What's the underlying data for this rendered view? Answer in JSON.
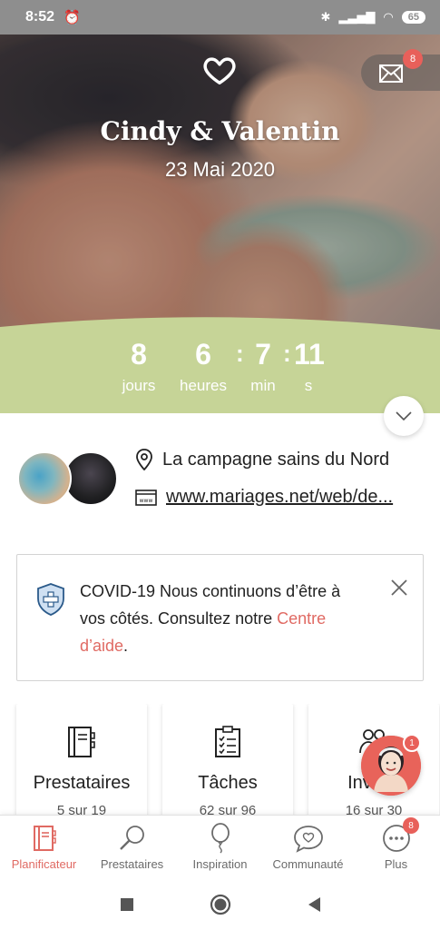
{
  "status_bar": {
    "time": "8:52",
    "battery": "65"
  },
  "hero": {
    "couple_names": "Cindy & Valentin",
    "wedding_date": "23 Mai 2020",
    "mail_badge": "8"
  },
  "countdown": {
    "days": {
      "value": "8",
      "label": "jours"
    },
    "hours": {
      "value": "6",
      "label": "heures"
    },
    "minutes": {
      "value": "7",
      "label": "min"
    },
    "seconds": {
      "value": "11",
      "label": "s"
    }
  },
  "info": {
    "location": "La campagne sains du Nord",
    "website": "www.mariages.net/web/de..."
  },
  "covid": {
    "text": "COVID-19 Nous continuons d’être à vos côtés. Consultez notre ",
    "link": "Centre d’aide",
    "end": "."
  },
  "cards": [
    {
      "title": "Prestataires",
      "subtitle": "5 sur 19",
      "icon": "address-book-icon"
    },
    {
      "title": "Tâches",
      "subtitle": "62 sur 96",
      "icon": "checklist-icon"
    },
    {
      "title": "Invités",
      "subtitle": "16 sur 30",
      "icon": "guests-icon"
    }
  ],
  "chat_badge": "1",
  "bottom_nav": [
    {
      "label": "Planificateur",
      "icon": "planner-icon",
      "active": true
    },
    {
      "label": "Prestataires",
      "icon": "search-icon"
    },
    {
      "label": "Inspiration",
      "icon": "balloon-icon"
    },
    {
      "label": "Communauté",
      "icon": "chat-heart-icon"
    },
    {
      "label": "Plus",
      "icon": "more-icon",
      "badge": "8"
    }
  ],
  "colors": {
    "accent": "#e06a63",
    "countdown_bg": "#c6d497"
  }
}
